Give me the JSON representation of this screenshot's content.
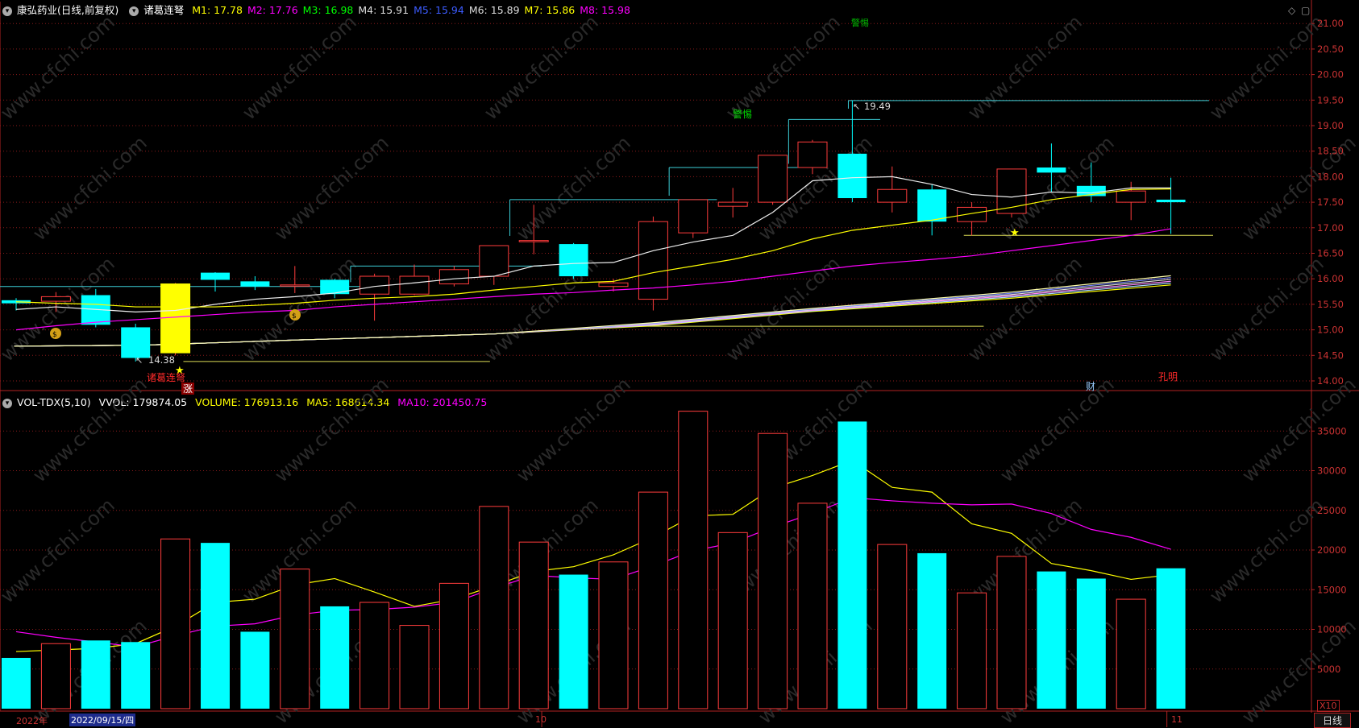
{
  "main_info": {
    "title": "康弘药业(日线,前复权)",
    "indicator": "诸葛连弩",
    "ma": [
      {
        "label": "M1: 17.78",
        "color": "#ffff00"
      },
      {
        "label": "M2: 17.76",
        "color": "#ff00ff"
      },
      {
        "label": "M3: 16.98",
        "color": "#00ff00"
      },
      {
        "label": "M4: 15.91",
        "color": "#dddddd"
      },
      {
        "label": "M5: 15.94",
        "color": "#3c5cff"
      },
      {
        "label": "M6: 15.89",
        "color": "#dddddd"
      },
      {
        "label": "M7: 15.86",
        "color": "#ffff00"
      },
      {
        "label": "M8: 15.98",
        "color": "#ff00ff"
      }
    ]
  },
  "vol_info": {
    "name": "VOL-TDX(5,10)",
    "vvol": "VVOL: 179874.05",
    "volume": "VOLUME: 176913.16",
    "ma5": "MA5: 168614.34",
    "ma10": "MA10: 201450.75"
  },
  "price_axis": [
    "21.00",
    "20.50",
    "20.00",
    "19.50",
    "19.00",
    "18.50",
    "18.00",
    "17.50",
    "17.00",
    "16.50",
    "16.00",
    "15.50",
    "15.00",
    "14.50",
    "14.00"
  ],
  "vol_axis": [
    "35000",
    "30000",
    "25000",
    "20000",
    "15000",
    "10000",
    "5000"
  ],
  "vol_multiplier": "X10",
  "date_axis": {
    "year": "2022年",
    "selected": "2022/09/15/四",
    "oct": "10",
    "nov": "11"
  },
  "period_label": "日线",
  "annotations": {
    "low": "14.38",
    "high": "19.49",
    "signal1": "诸葛连弩",
    "signal_zhang": "涨",
    "warn": "警惕",
    "warn_top": "警惕",
    "cai": "财",
    "kongming": "孔明"
  },
  "watermark": "www.cfchi.com",
  "colors": {
    "up": "#ff3c3c",
    "down": "#00ffff",
    "grid": "#8b1a1a",
    "axis": "#b22222"
  },
  "chart_data": {
    "type": "candlestick",
    "candles": [
      {
        "o": 15.58,
        "h": 15.62,
        "l": 15.38,
        "c": 15.52,
        "v": 6400
      },
      {
        "o": 15.56,
        "h": 15.74,
        "l": 15.35,
        "c": 15.65,
        "v": 8200
      },
      {
        "o": 15.68,
        "h": 15.8,
        "l": 15.05,
        "c": 15.1,
        "v": 8600
      },
      {
        "o": 15.05,
        "h": 15.12,
        "l": 14.38,
        "c": 14.45,
        "v": 8400
      },
      {
        "o": 14.55,
        "h": 15.92,
        "l": 14.5,
        "c": 15.9,
        "v": 21400
      },
      {
        "o": 16.12,
        "h": 16.13,
        "l": 15.75,
        "c": 15.98,
        "v": 20900
      },
      {
        "o": 15.95,
        "h": 16.05,
        "l": 15.78,
        "c": 15.85,
        "v": 9700
      },
      {
        "o": 15.88,
        "h": 16.25,
        "l": 15.72,
        "c": 15.88,
        "v": 17600
      },
      {
        "o": 15.98,
        "h": 16.0,
        "l": 15.62,
        "c": 15.7,
        "v": 12900
      },
      {
        "o": 15.7,
        "h": 16.1,
        "l": 15.18,
        "c": 16.05,
        "v": 13400
      },
      {
        "o": 15.7,
        "h": 16.28,
        "l": 15.68,
        "c": 16.05,
        "v": 10500
      },
      {
        "o": 15.9,
        "h": 16.25,
        "l": 15.85,
        "c": 16.18,
        "v": 15800
      },
      {
        "o": 16.05,
        "h": 16.65,
        "l": 15.88,
        "c": 16.65,
        "v": 25500
      },
      {
        "o": 16.75,
        "h": 17.45,
        "l": 16.48,
        "c": 16.75,
        "v": 21000
      },
      {
        "o": 16.68,
        "h": 16.7,
        "l": 16.0,
        "c": 16.05,
        "v": 16900
      },
      {
        "o": 15.85,
        "h": 16.0,
        "l": 15.75,
        "c": 15.92,
        "v": 18500
      },
      {
        "o": 15.6,
        "h": 17.22,
        "l": 15.38,
        "c": 17.12,
        "v": 27300
      },
      {
        "o": 16.9,
        "h": 17.55,
        "l": 16.8,
        "c": 17.55,
        "v": 37500
      },
      {
        "o": 17.42,
        "h": 17.78,
        "l": 17.2,
        "c": 17.5,
        "v": 22200
      },
      {
        "o": 17.5,
        "h": 18.42,
        "l": 17.45,
        "c": 18.42,
        "v": 34700
      },
      {
        "o": 18.18,
        "h": 18.72,
        "l": 18.05,
        "c": 18.68,
        "v": 25900
      },
      {
        "o": 18.45,
        "h": 19.49,
        "l": 17.5,
        "c": 17.58,
        "v": 36200
      },
      {
        "o": 17.5,
        "h": 18.2,
        "l": 17.3,
        "c": 17.75,
        "v": 20700
      },
      {
        "o": 17.75,
        "h": 17.85,
        "l": 16.85,
        "c": 17.12,
        "v": 19600
      },
      {
        "o": 17.12,
        "h": 17.5,
        "l": 16.85,
        "c": 17.4,
        "v": 14600
      },
      {
        "o": 17.28,
        "h": 18.15,
        "l": 17.2,
        "c": 18.15,
        "v": 19200
      },
      {
        "o": 18.18,
        "h": 18.65,
        "l": 17.7,
        "c": 18.08,
        "v": 17300
      },
      {
        "o": 17.82,
        "h": 18.28,
        "l": 17.5,
        "c": 17.62,
        "v": 16400
      },
      {
        "o": 17.5,
        "h": 17.9,
        "l": 17.15,
        "c": 17.72,
        "v": 13800
      },
      {
        "o": 17.55,
        "h": 17.98,
        "l": 16.88,
        "c": 17.5,
        "v": 17700
      }
    ],
    "ma_white": [
      15.4,
      15.45,
      15.4,
      15.35,
      15.38,
      15.5,
      15.6,
      15.65,
      15.72,
      15.85,
      15.92,
      16.0,
      16.05,
      16.25,
      16.3,
      16.32,
      16.55,
      16.72,
      16.85,
      17.3,
      17.92,
      17.98,
      18.0,
      17.85,
      17.65,
      17.6,
      17.7,
      17.68,
      17.78,
      17.78
    ],
    "ma_yellow": [
      15.55,
      15.52,
      15.5,
      15.45,
      15.45,
      15.45,
      15.48,
      15.52,
      15.58,
      15.62,
      15.65,
      15.7,
      15.78,
      15.85,
      15.92,
      15.95,
      16.12,
      16.25,
      16.38,
      16.55,
      16.78,
      16.95,
      17.05,
      17.15,
      17.28,
      17.4,
      17.55,
      17.65,
      17.75,
      17.76
    ],
    "ma_magenta": [
      15.0,
      15.08,
      15.15,
      15.2,
      15.25,
      15.3,
      15.35,
      15.38,
      15.45,
      15.5,
      15.55,
      15.6,
      15.65,
      15.7,
      15.73,
      15.78,
      15.82,
      15.88,
      15.95,
      16.05,
      16.15,
      16.25,
      16.32,
      16.38,
      16.45,
      16.55,
      16.65,
      16.75,
      16.85,
      16.98
    ],
    "vol_ma5": [
      7200,
      7400,
      7600,
      8200,
      10400,
      13400,
      13800,
      15600,
      16400,
      14700,
      12900,
      13800,
      15500,
      17300,
      17900,
      19400,
      21600,
      24300,
      24500,
      27800,
      29400,
      31300,
      27900,
      27300,
      23300,
      22100,
      18300,
      17400,
      16300,
      16900
    ],
    "vol_ma10": [
      9700,
      9000,
      8400,
      7800,
      9200,
      10400,
      10700,
      11800,
      12400,
      12500,
      12800,
      13400,
      15200,
      16800,
      16500,
      16300,
      18000,
      19900,
      20900,
      22900,
      24600,
      26600,
      26200,
      25900,
      25700,
      25800,
      24600,
      22600,
      21600,
      20100
    ]
  }
}
